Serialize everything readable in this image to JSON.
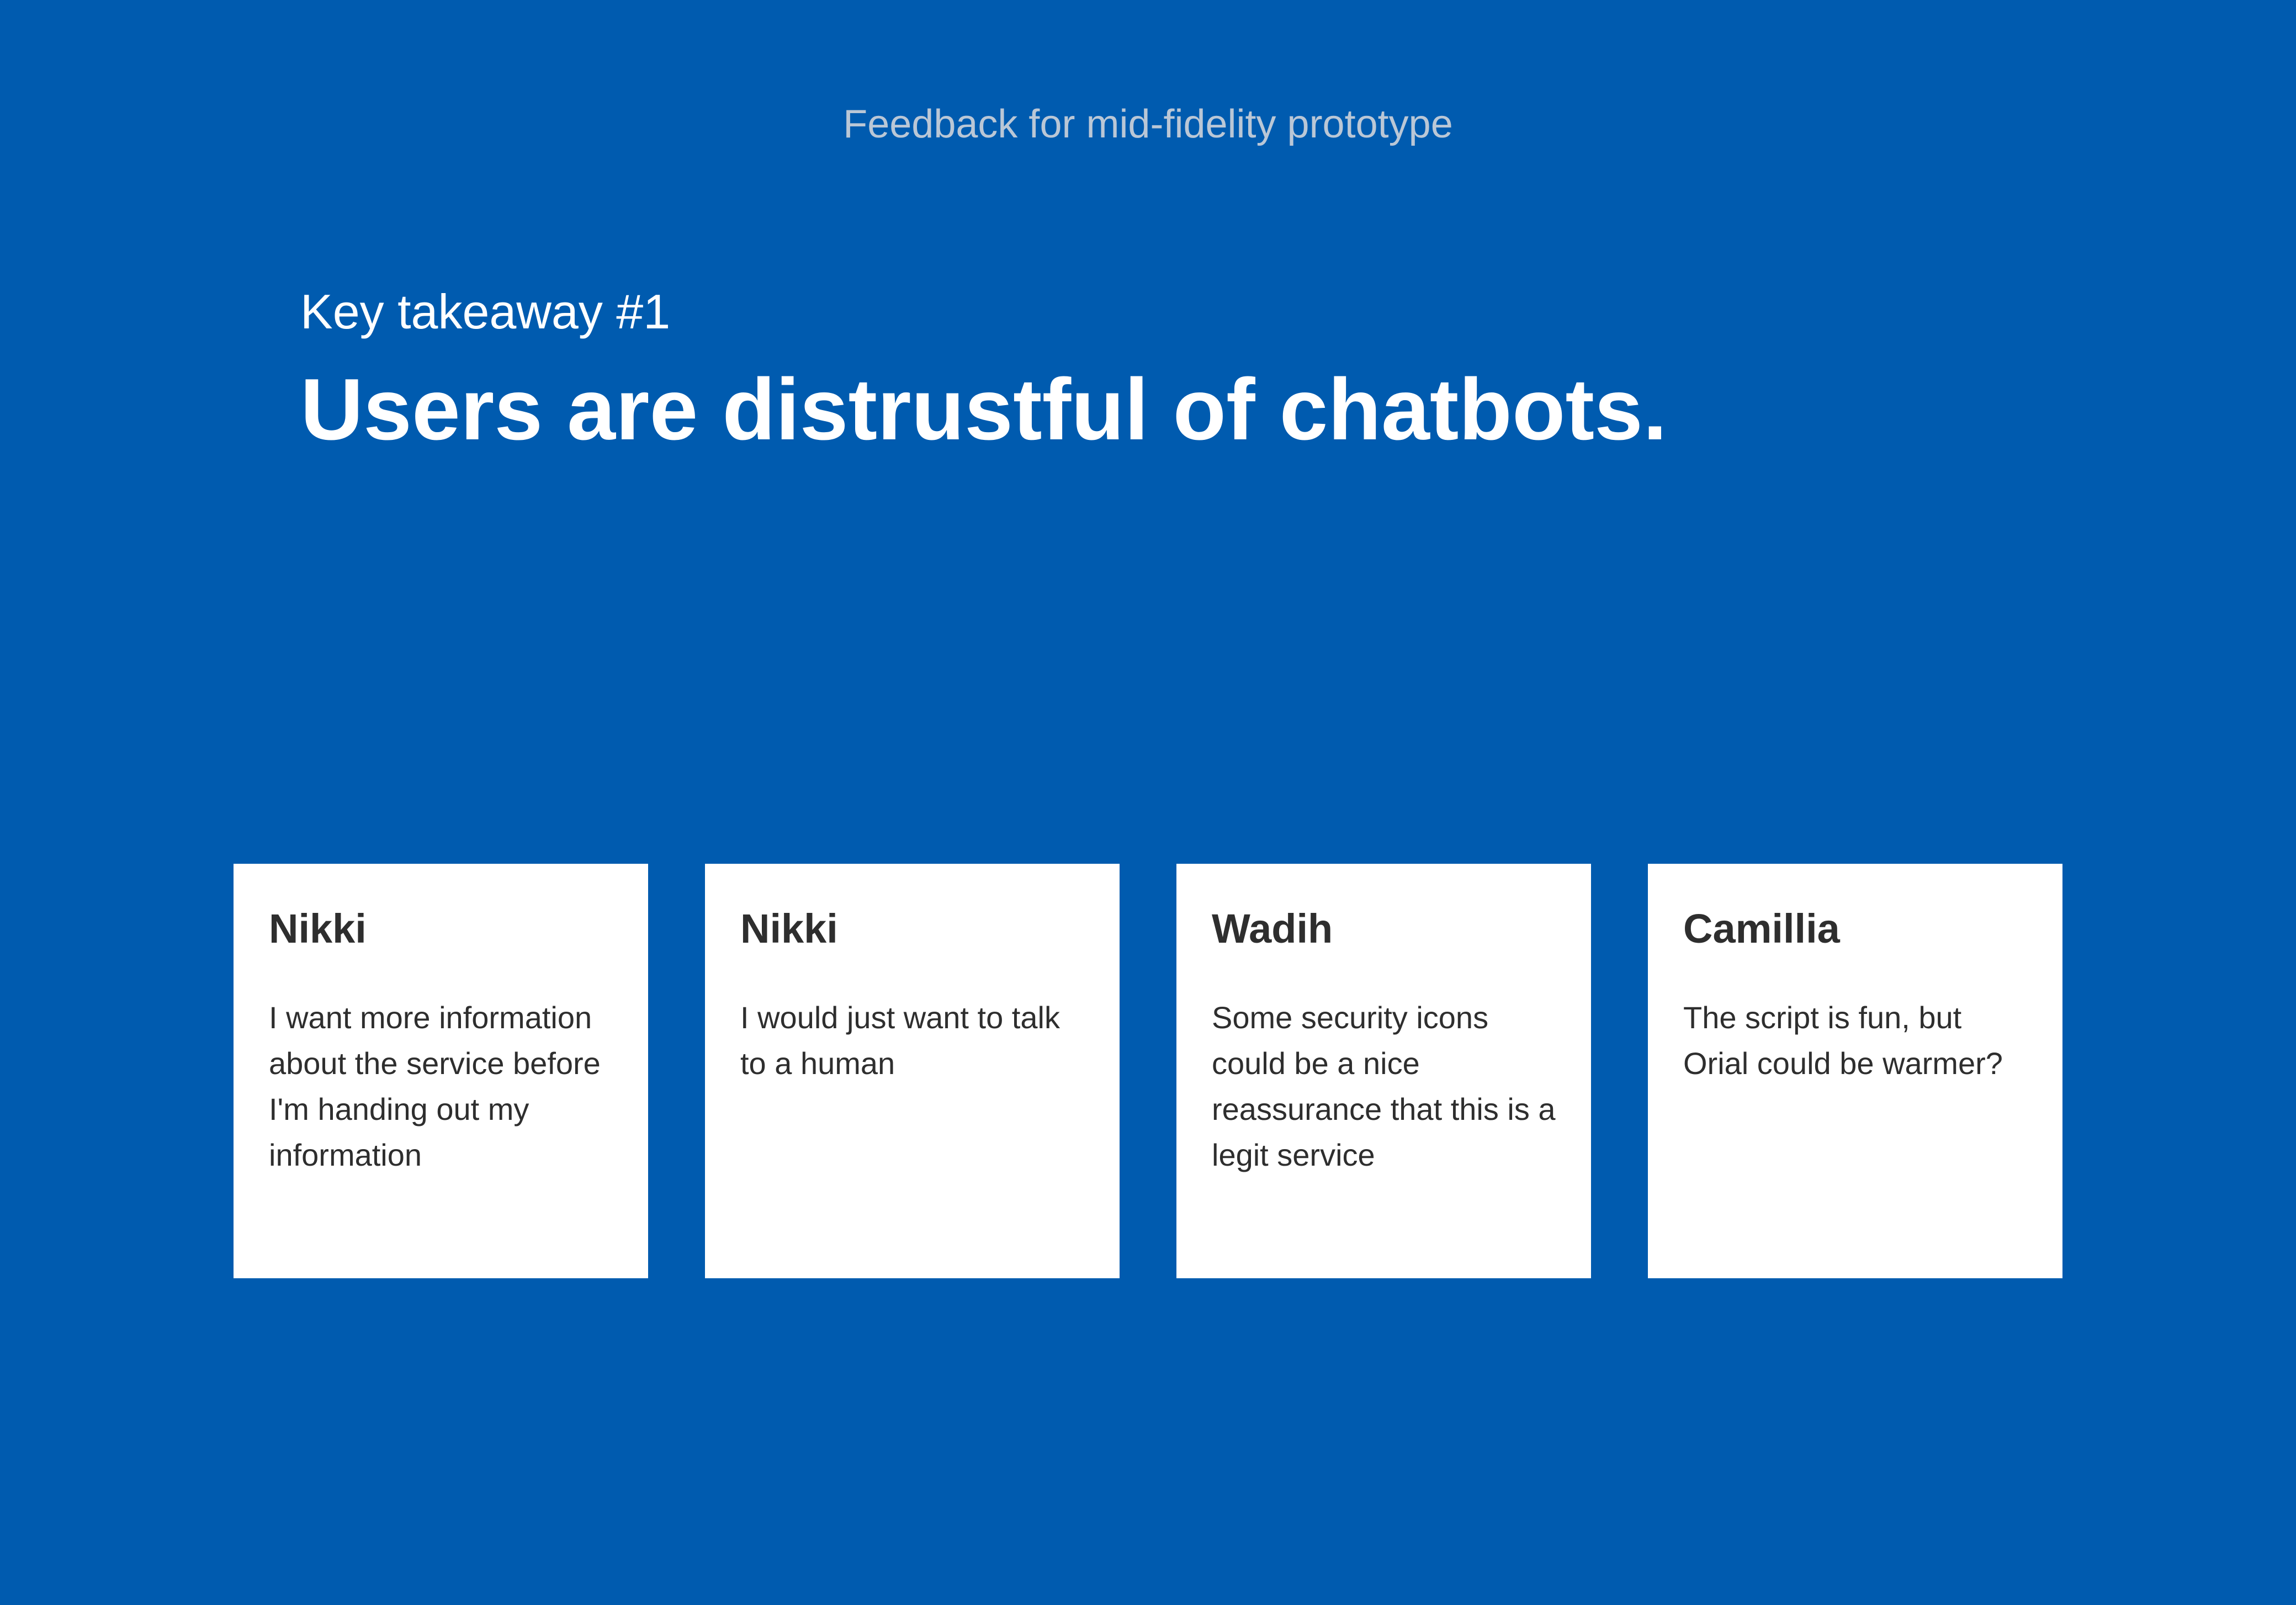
{
  "header": {
    "subtitle": "Feedback for mid-fidelity prototype"
  },
  "takeaway": {
    "label": "Key takeaway #1",
    "headline": "Users are distrustful of chatbots."
  },
  "cards": [
    {
      "name": "Nikki",
      "quote": "I want more information about the service before I'm handing out my information"
    },
    {
      "name": "Nikki",
      "quote": "I would just want to talk to a human"
    },
    {
      "name": "Wadih",
      "quote": "Some security icons could be a nice reassurance that this is a legit service"
    },
    {
      "name": "Camillia",
      "quote": "The script is fun, but Orial could be warmer?"
    }
  ],
  "colors": {
    "background": "#005baf",
    "card": "#ffffff",
    "card_text": "#2e2e2e",
    "subtitle": "#bac7d6"
  }
}
